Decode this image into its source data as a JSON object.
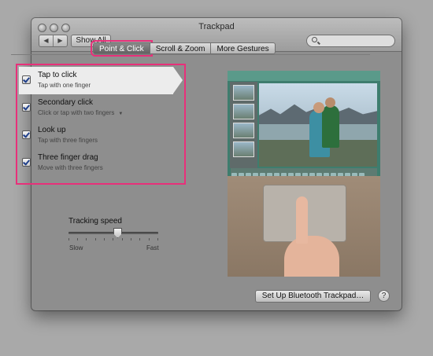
{
  "window": {
    "title": "Trackpad"
  },
  "toolbar": {
    "back_icon": "◀",
    "forward_icon": "▶",
    "show_all_label": "Show All",
    "search_placeholder": ""
  },
  "tabs": [
    {
      "label": "Point & Click",
      "active": true
    },
    {
      "label": "Scroll & Zoom",
      "active": false
    },
    {
      "label": "More Gestures",
      "active": false
    }
  ],
  "gestures": [
    {
      "title": "Tap to click",
      "subtitle": "Tap with one finger",
      "checked": true,
      "selected": true
    },
    {
      "title": "Secondary click",
      "subtitle": "Click or tap with two fingers",
      "checked": true,
      "has_menu": true
    },
    {
      "title": "Look up",
      "subtitle": "Tap with three fingers",
      "checked": true
    },
    {
      "title": "Three finger drag",
      "subtitle": "Move with three fingers",
      "checked": true
    }
  ],
  "tracking": {
    "label": "Tracking speed",
    "slow_label": "Slow",
    "fast_label": "Fast",
    "value": 0.55
  },
  "footer": {
    "bluetooth_label": "Set Up Bluetooth Trackpad…",
    "help_label": "?"
  },
  "colors": {
    "highlight": "#e8307a"
  }
}
